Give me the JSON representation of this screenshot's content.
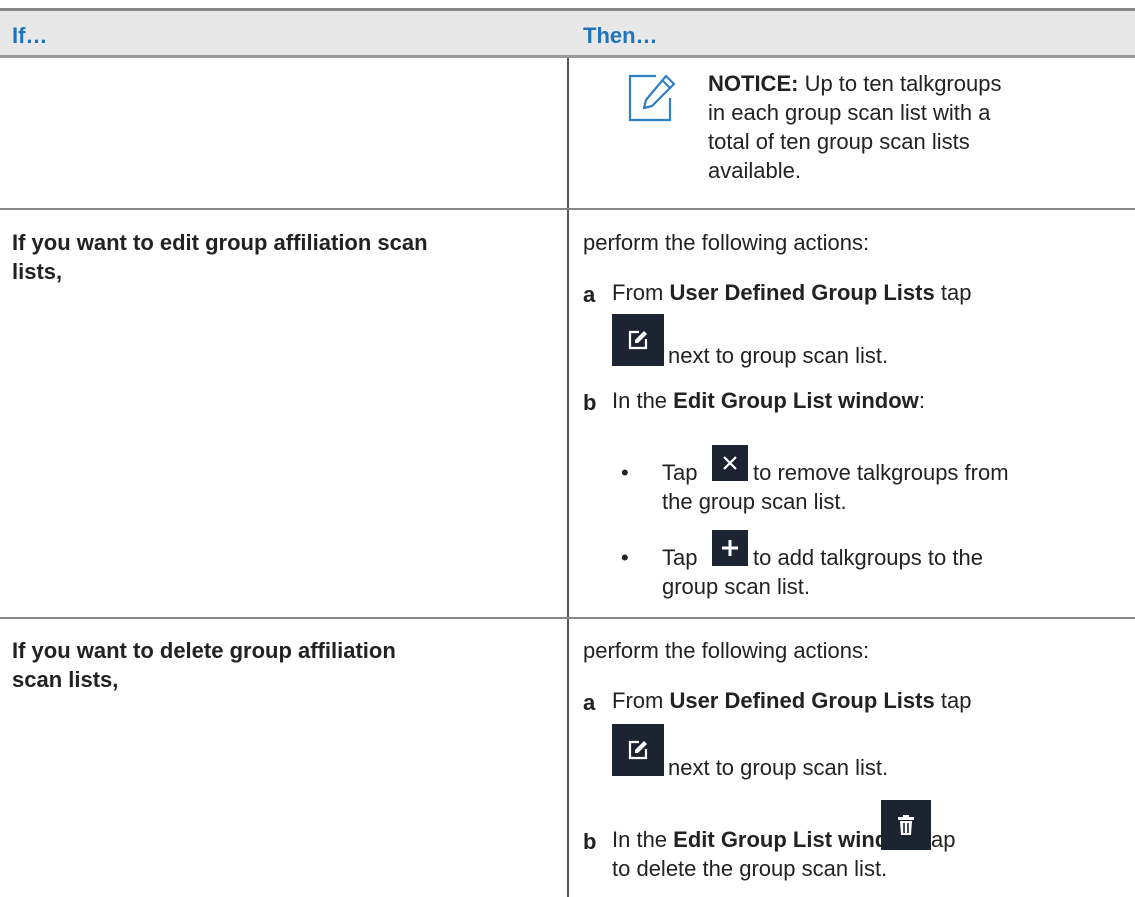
{
  "header": {
    "if_label": "If…",
    "then_label": "Then…"
  },
  "row0": {
    "notice_bold": "NOTICE:",
    "notice_line1": " Up to ten talkgroups",
    "notice_line2": "in each group scan list with a",
    "notice_line3": "total of ten group scan lists",
    "notice_line4": "available."
  },
  "row1": {
    "condition_line1": "If you want to edit group affiliation scan",
    "condition_line2": "lists,",
    "intro": "perform the following actions:",
    "step_a": {
      "letter": "a",
      "prefix": "From ",
      "bold": "User Defined Group Lists",
      "suffix": " tap",
      "after_icon": "next to group scan list."
    },
    "step_b": {
      "letter": "b",
      "prefix": "In the ",
      "bold": "Edit Group List window",
      "suffix": ":"
    },
    "bullet1": {
      "tap": "Tap",
      "rest_line1": "to remove talkgroups from",
      "rest_line2": "the group scan list."
    },
    "bullet2": {
      "tap": "Tap",
      "rest_line1": "to add talkgroups to the",
      "rest_line2": "group scan list."
    }
  },
  "row2": {
    "condition_line1": "If you want to delete group affiliation",
    "condition_line2": "scan lists,",
    "intro": "perform the following actions:",
    "step_a": {
      "letter": "a",
      "prefix": "From ",
      "bold": "User Defined Group Lists",
      "suffix": " tap",
      "after_icon": "next to group scan list."
    },
    "step_b": {
      "letter": "b",
      "prefix": "In the ",
      "bold": "Edit Group List window",
      "suffix": " tap",
      "line2": "to delete the group scan list."
    }
  },
  "icons": {
    "notice": "notice-pencil-icon",
    "edit": "edit-icon",
    "remove": "close-icon",
    "add": "plus-icon",
    "delete": "trash-icon"
  },
  "colors": {
    "header_text": "#1f74bd",
    "header_bg": "#e8e8e8",
    "icon_bg": "#1b2430",
    "notice_icon": "#2e7fc4"
  }
}
